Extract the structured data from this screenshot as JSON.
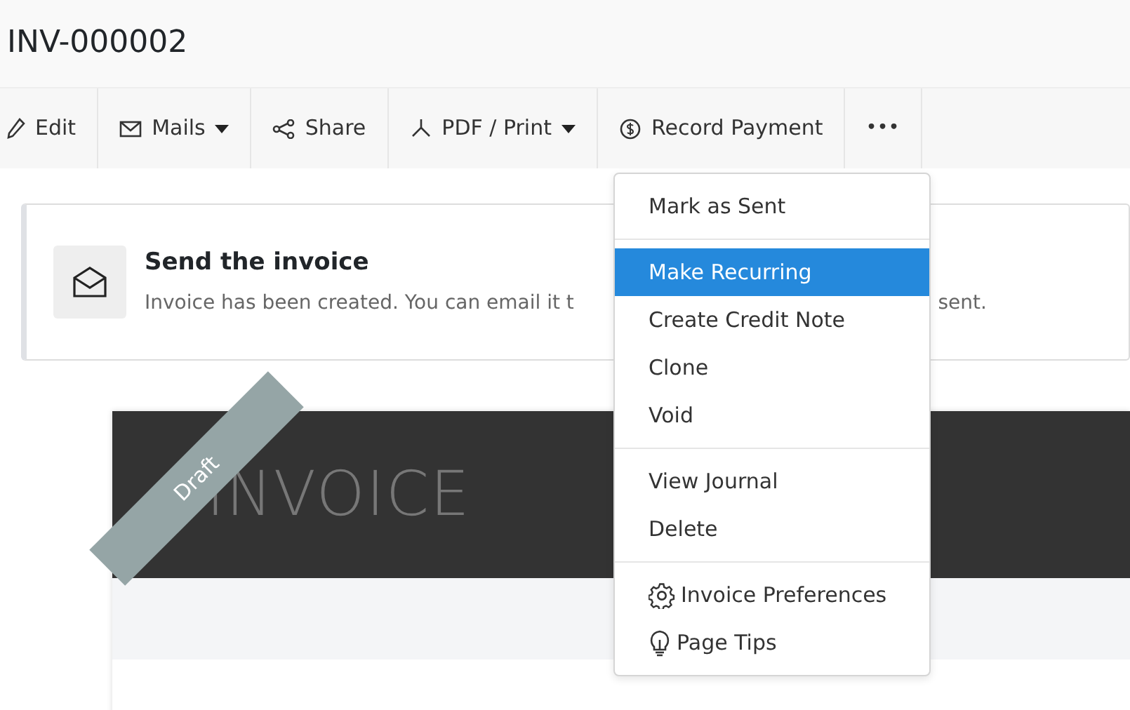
{
  "page_title": "INV-000002",
  "toolbar": [
    {
      "label": "Edit",
      "kind": "pencil",
      "dropdown": false
    },
    {
      "label": "Mails",
      "kind": "mail",
      "dropdown": true
    },
    {
      "label": "Share",
      "kind": "share",
      "dropdown": false
    },
    {
      "label": "PDF / Print",
      "kind": "pdf",
      "dropdown": true
    },
    {
      "label": "Record Payment",
      "kind": "payment",
      "dropdown": false
    },
    {
      "label": "•••",
      "kind": "more",
      "dropdown": false
    }
  ],
  "banner": {
    "title": "Send the invoice",
    "text_left": "Invoice has been created. You can email it t",
    "text_right": "sent."
  },
  "invoice": {
    "ribbon": "Draft",
    "heading": "INVOICE"
  },
  "menu": {
    "groups": [
      {
        "items": [
          {
            "label": "Mark as Sent",
            "selected": false,
            "kind": "plain"
          }
        ]
      },
      {
        "items": [
          {
            "label": "Make Recurring",
            "selected": true,
            "kind": "plain"
          },
          {
            "label": "Create Credit Note",
            "selected": false,
            "kind": "plain"
          },
          {
            "label": "Clone",
            "selected": false,
            "kind": "plain"
          },
          {
            "label": "Void",
            "selected": false,
            "kind": "plain"
          }
        ]
      },
      {
        "items": [
          {
            "label": "View Journal",
            "selected": false,
            "kind": "plain"
          },
          {
            "label": "Delete",
            "selected": false,
            "kind": "plain"
          }
        ]
      },
      {
        "items": [
          {
            "label": "Invoice Preferences",
            "selected": false,
            "kind": "gear"
          },
          {
            "label": "Page Tips",
            "selected": false,
            "kind": "bulb"
          }
        ]
      }
    ]
  }
}
